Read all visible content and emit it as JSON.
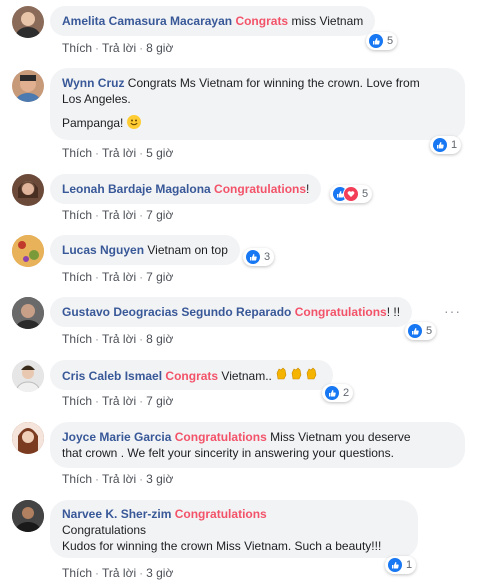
{
  "actions": {
    "like": "Thích",
    "reply": "Trả lời",
    "sep": "·"
  },
  "comments": [
    {
      "name": "Amelita Camasura Macarayan",
      "highlight": "Congrats",
      "text": " miss Vietnam",
      "time": "8 giờ",
      "reactions": "5",
      "avatar_color": "#8a6a58"
    },
    {
      "name": "Wynn Cruz",
      "text_line1": " Congrats Ms Vietnam for winning the crown. Love from",
      "text_line2": "Los Angeles.",
      "text_line3": "Pampanga!",
      "time": "5 giờ",
      "reactions": "1",
      "avatar_color": "#c79a7a"
    },
    {
      "name": "Leonah Bardaje Magalona",
      "highlight": "Congratulations",
      "text": "!",
      "time": "7 giờ",
      "reactions": "5",
      "avatar_color": "#6b4a3a"
    },
    {
      "name": "Lucas Nguyen",
      "text": " Vietnam on top",
      "time": "7 giờ",
      "reactions": "3",
      "avatar_color": "#d8a24a"
    },
    {
      "name": "Gustavo Deogracias Segundo Reparado",
      "highlight": "Congratulations",
      "text": "! !!",
      "time": "8 giờ",
      "reactions": "5",
      "more": "···",
      "avatar_color": "#5a5a5a"
    },
    {
      "name": "Cris Caleb Ismael",
      "highlight": "Congrats",
      "text": " Vietnam..",
      "time": "7 giờ",
      "reactions": "2",
      "avatar_color": "#d9d9d9"
    },
    {
      "name": "Joyce Marie Garcia",
      "highlight": "Congratulations",
      "text_line1": " Miss Vietnam you deserve",
      "text_line2": "that crown . We felt your sincerity in answering your questions.",
      "time": "3 giờ",
      "avatar_color": "#a0522d"
    },
    {
      "name": "Narvee K. Sher-zim",
      "highlight": "Congratulations",
      "text_line2": "Congratulations",
      "text_line3": "Kudos for winning the crown Miss Vietnam. Such a beauty!!!",
      "time": "3 giờ",
      "reactions": "1",
      "avatar_color": "#3c3c3c"
    }
  ]
}
